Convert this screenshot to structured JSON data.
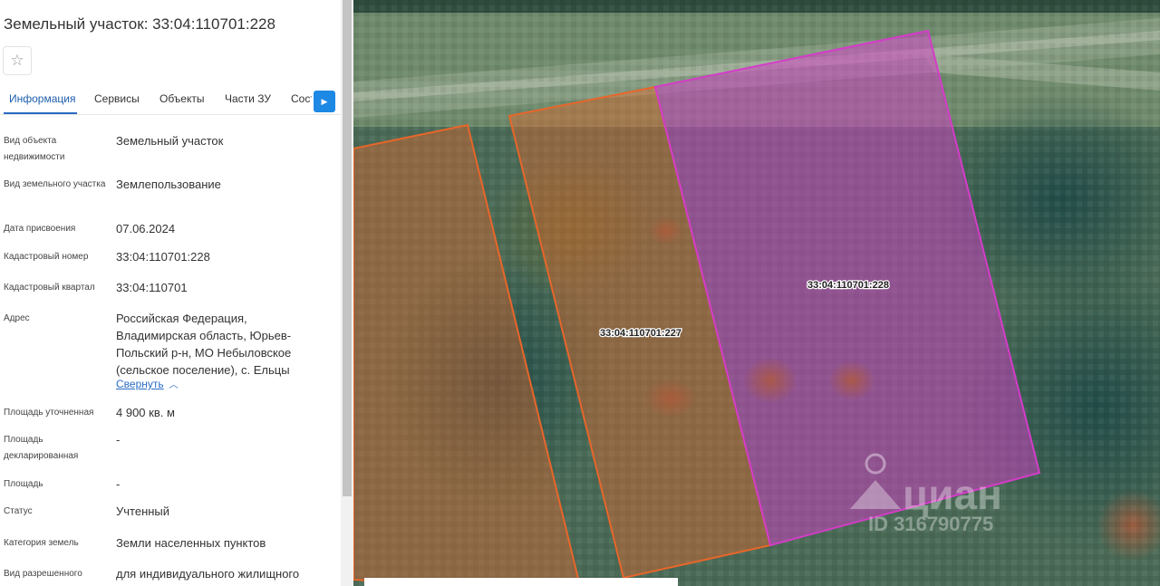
{
  "panel": {
    "title": "Земельный участок: 33:04:110701:228",
    "favorite_icon": "star-outline-icon",
    "tabs": [
      "Информация",
      "Сервисы",
      "Объекты",
      "Части ЗУ",
      "Сост"
    ],
    "tab_scroll_icon": "chevron-right-icon",
    "fields": [
      {
        "label": "Вид объекта недвижимости",
        "value": "Земельный участок"
      },
      {
        "label": "Вид земельного участка",
        "value": "Землепользование"
      },
      {
        "label": "Дата присвоения",
        "value": "07.06.2024"
      },
      {
        "label": "Кадастровый номер",
        "value": "33:04:110701:228"
      },
      {
        "label": "Кадастровый квартал",
        "value": "33:04:110701"
      },
      {
        "label": "Адрес",
        "value": "Российская Федерация, Владимирская область, Юрьев-Польский р-н, МО Небыловское (сельское поселение), с. Ельцы"
      },
      {
        "label": "Площадь уточненная",
        "value": "4 900 кв. м"
      },
      {
        "label": "Площадь декларированная",
        "value": "-"
      },
      {
        "label": "Площадь",
        "value": "-"
      },
      {
        "label": "Статус",
        "value": "Учтенный"
      },
      {
        "label": "Категория земель",
        "value": "Земли населенных пунктов"
      },
      {
        "label": "Вид разрешенного",
        "value": "для индивидуального жилищного"
      }
    ],
    "collapse_label": "Свернуть"
  },
  "map": {
    "parcels": [
      {
        "label": "33:04:110701:227",
        "color": "#e8662a"
      },
      {
        "label": "33:04:110701:228",
        "color": "#d43cc8"
      }
    ],
    "watermark_brand": "циан",
    "watermark_id": "ID 316790775"
  },
  "colors": {
    "accent": "#2b6cc4",
    "tab_scroll": "#1e88e5"
  }
}
